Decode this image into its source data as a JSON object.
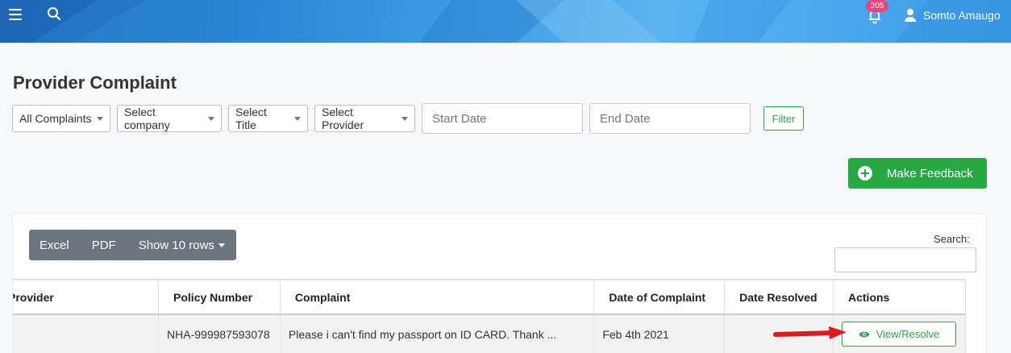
{
  "header": {
    "notification_count": "205",
    "user_name": "Somto Amaugo",
    "icons": [
      "menu-icon",
      "search-icon",
      "bell-icon",
      "user-icon"
    ]
  },
  "page": {
    "title": "Provider Complaint"
  },
  "filters": {
    "complaints": "All Complaints",
    "company": "Select company",
    "title": "Select Title",
    "provider": "Select Provider",
    "start_date_placeholder": "Start Date",
    "end_date_placeholder": "End Date",
    "filter_label": "Filter"
  },
  "actions": {
    "make_feedback": "Make Feedback"
  },
  "table_tools": {
    "excel": "Excel",
    "pdf": "PDF",
    "rows": "Show 10 rows",
    "search_label": "Search:"
  },
  "table": {
    "columns": [
      "Provider",
      "Policy Number",
      "Complaint",
      "Date of Complaint",
      "Date Resolved",
      "Actions"
    ],
    "rows": [
      {
        "provider": "",
        "policy_number": "NHA-999987593078",
        "complaint": "Please i can't find my passport on ID CARD. Thank ...",
        "date_of_complaint": "Feb 4th 2021",
        "date_resolved": "",
        "action": "View/Resolve"
      }
    ]
  },
  "colors": {
    "success": "#28a745",
    "badge": "#e8457a",
    "annotation_arrow": "#e0191e"
  }
}
